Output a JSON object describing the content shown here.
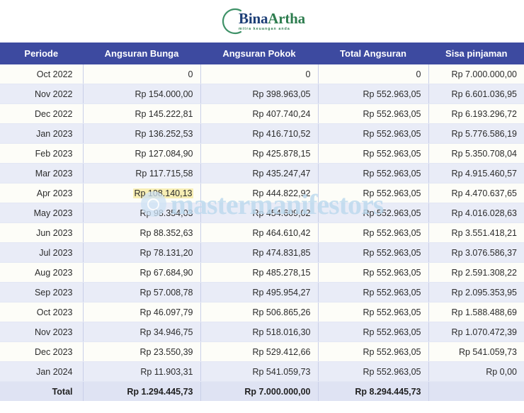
{
  "logo": {
    "name_part1": "Bina",
    "name_part2": "Artha",
    "tagline": "mitra keuangan anda",
    "arc_color": "#3f9268",
    "text_color": "#1d3f77"
  },
  "watermark": {
    "text": "mastermanifestors",
    "color": "#bcd9ee"
  },
  "table": {
    "headers": [
      "Periode",
      "Angsuran Bunga",
      "Angsuran Pokok",
      "Total Angsuran",
      "Sisa pinjaman"
    ],
    "header_bg": "#3d4aa0",
    "rows": [
      {
        "periode": "Oct 2022",
        "bunga": "0",
        "pokok": "0",
        "total": "0",
        "sisa": "Rp 7.000.000,00"
      },
      {
        "periode": "Nov 2022",
        "bunga": "Rp 154.000,00",
        "pokok": "Rp 398.963,05",
        "total": "Rp 552.963,05",
        "sisa": "Rp 6.601.036,95"
      },
      {
        "periode": "Dec 2022",
        "bunga": "Rp 145.222,81",
        "pokok": "Rp 407.740,24",
        "total": "Rp 552.963,05",
        "sisa": "Rp 6.193.296,72"
      },
      {
        "periode": "Jan 2023",
        "bunga": "Rp 136.252,53",
        "pokok": "Rp 416.710,52",
        "total": "Rp 552.963,05",
        "sisa": "Rp 5.776.586,19"
      },
      {
        "periode": "Feb 2023",
        "bunga": "Rp 127.084,90",
        "pokok": "Rp 425.878,15",
        "total": "Rp 552.963,05",
        "sisa": "Rp 5.350.708,04"
      },
      {
        "periode": "Mar 2023",
        "bunga": "Rp 117.715,58",
        "pokok": "Rp 435.247,47",
        "total": "Rp 552.963,05",
        "sisa": "Rp 4.915.460,57"
      },
      {
        "periode": "Apr 2023",
        "bunga": "Rp 108.140,13",
        "pokok": "Rp 444.822,92",
        "total": "Rp 552.963,05",
        "sisa": "Rp 4.470.637,65",
        "highlight": true
      },
      {
        "periode": "May 2023",
        "bunga": "Rp 98.354,03",
        "pokok": "Rp 454.609,02",
        "total": "Rp 552.963,05",
        "sisa": "Rp 4.016.028,63"
      },
      {
        "periode": "Jun 2023",
        "bunga": "Rp 88.352,63",
        "pokok": "Rp 464.610,42",
        "total": "Rp 552.963,05",
        "sisa": "Rp 3.551.418,21"
      },
      {
        "periode": "Jul 2023",
        "bunga": "Rp 78.131,20",
        "pokok": "Rp 474.831,85",
        "total": "Rp 552.963,05",
        "sisa": "Rp 3.076.586,37"
      },
      {
        "periode": "Aug 2023",
        "bunga": "Rp 67.684,90",
        "pokok": "Rp 485.278,15",
        "total": "Rp 552.963,05",
        "sisa": "Rp 2.591.308,22"
      },
      {
        "periode": "Sep 2023",
        "bunga": "Rp 57.008,78",
        "pokok": "Rp 495.954,27",
        "total": "Rp 552.963,05",
        "sisa": "Rp 2.095.353,95"
      },
      {
        "periode": "Oct 2023",
        "bunga": "Rp 46.097,79",
        "pokok": "Rp 506.865,26",
        "total": "Rp 552.963,05",
        "sisa": "Rp 1.588.488,69"
      },
      {
        "periode": "Nov 2023",
        "bunga": "Rp 34.946,75",
        "pokok": "Rp 518.016,30",
        "total": "Rp 552.963,05",
        "sisa": "Rp 1.070.472,39"
      },
      {
        "periode": "Dec 2023",
        "bunga": "Rp 23.550,39",
        "pokok": "Rp 529.412,66",
        "total": "Rp 552.963,05",
        "sisa": "Rp 541.059,73"
      },
      {
        "periode": "Jan 2024",
        "bunga": "Rp 11.903,31",
        "pokok": "Rp 541.059,73",
        "total": "Rp 552.963,05",
        "sisa": "Rp 0,00"
      }
    ],
    "total_row": {
      "periode": "Total",
      "bunga": "Rp 1.294.445,73",
      "pokok": "Rp 7.000.000,00",
      "total": "Rp 8.294.445,73",
      "sisa": ""
    }
  }
}
